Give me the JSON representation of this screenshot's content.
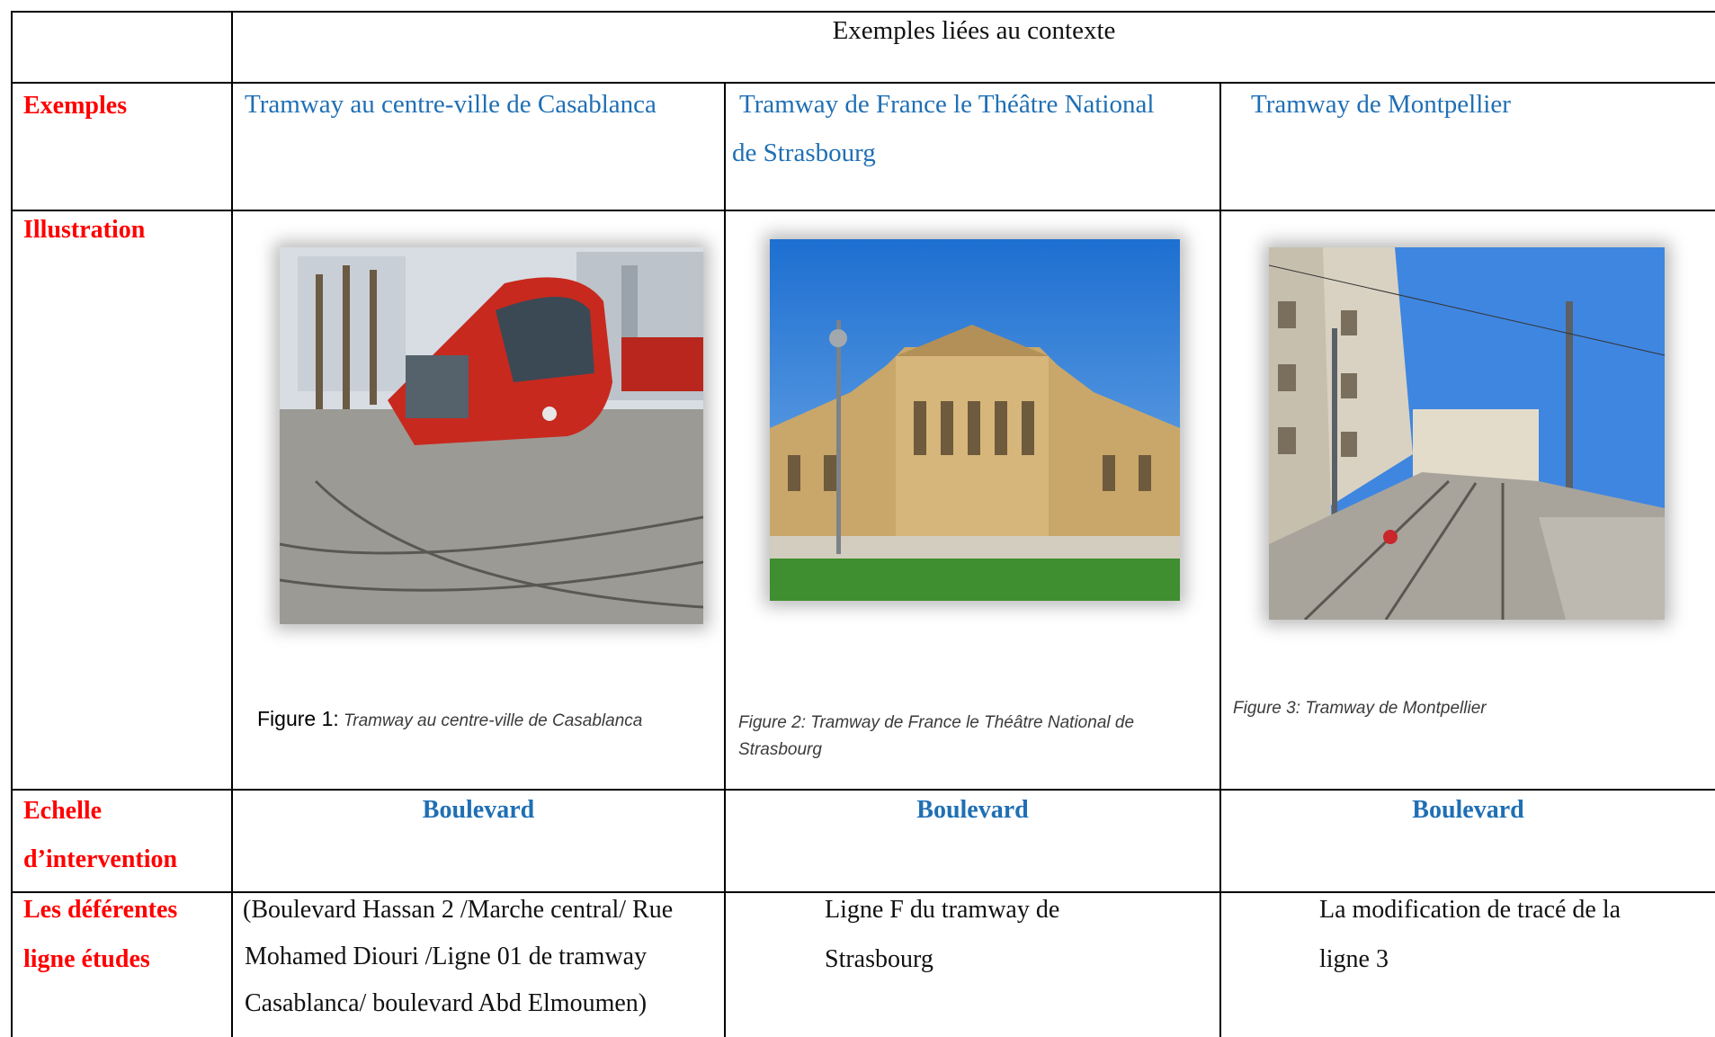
{
  "table": {
    "header": "Exemples liées au contexte",
    "row_labels": {
      "exemples": "Exemples",
      "illustration": "Illustration",
      "echelle_1": "Echelle",
      "echelle_2": "d’intervention",
      "lignes_1": "Les déférentes",
      "lignes_2": "ligne études"
    },
    "columns": [
      {
        "example": "Tramway au centre-ville de Casablanca",
        "image": "red-tramway-photo",
        "caption_prefix": "Figure 1:",
        "caption": "Tramway au centre-ville de Casablanca",
        "scale": "Boulevard",
        "lines": [
          "(Boulevard Hassan 2 /Marche central/ Rue",
          "Mohamed Diouri /Ligne 01 de tramway",
          "Casablanca/ boulevard Abd Elmoumen)"
        ]
      },
      {
        "example_1": "Tramway de France le Théâtre National",
        "example_2": "de Strasbourg",
        "image": "theatre-building-photo",
        "caption_1": "Figure 2:  Tramway de France le Théâtre National de",
        "caption_2": "Strasbourg",
        "scale": "Boulevard",
        "lines": [
          "Ligne F du tramway de",
          "Strasbourg"
        ]
      },
      {
        "example": "Tramway de Montpellier",
        "image": "street-tram-tracks-photo",
        "caption": "Figure 3: Tramway de Montpellier",
        "scale": "Boulevard",
        "lines": [
          "La modification de tracé de la",
          "ligne 3"
        ]
      }
    ]
  }
}
